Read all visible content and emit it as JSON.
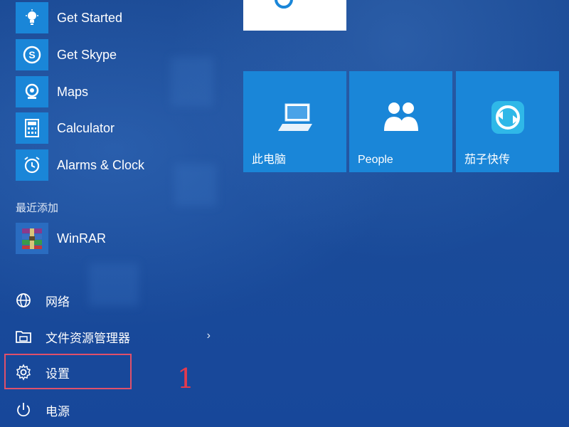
{
  "start_menu": {
    "apps": [
      {
        "label": "Get Started",
        "icon": "lightbulb-icon"
      },
      {
        "label": "Get Skype",
        "icon": "skype-icon"
      },
      {
        "label": "Maps",
        "icon": "maps-camera-icon"
      },
      {
        "label": "Calculator",
        "icon": "calculator-icon"
      },
      {
        "label": "Alarms & Clock",
        "icon": "alarm-clock-icon"
      }
    ],
    "recent_section_label": "最近添加",
    "recent_apps": [
      {
        "label": "WinRAR",
        "icon": "winrar-icon"
      }
    ],
    "system_items": [
      {
        "label": "网络",
        "icon": "network-globe-icon"
      },
      {
        "label": "文件资源管理器",
        "icon": "file-explorer-icon",
        "has_chevron": true
      },
      {
        "label": "设置",
        "icon": "gear-icon",
        "highlighted": true
      },
      {
        "label": "电源",
        "icon": "power-icon"
      }
    ],
    "annotation_number": "1"
  },
  "tiles": [
    {
      "label": "此电脑",
      "icon": "computer-icon"
    },
    {
      "label": "People",
      "icon": "people-icon"
    },
    {
      "label": "茄子快传",
      "icon": "transfer-app-icon"
    }
  ],
  "colors": {
    "background": "#1e4f9a",
    "tile": "#1a86d8",
    "highlight_box": "#e0506a",
    "annotation": "#e23a4e"
  }
}
